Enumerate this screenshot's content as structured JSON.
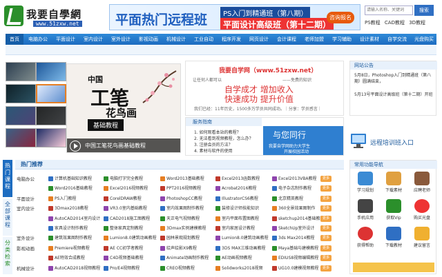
{
  "header": {
    "logo_text": "我要自學網",
    "logo_url": "www.51zxw.net",
    "banner": {
      "main": "平面热门远程班",
      "line1": "PS入门到精通班（第八期）",
      "line2": "平面设计高级班（第十二期）",
      "button": "咨询报名"
    },
    "search_placeholder": "请输入名称、关键词",
    "search_button": "搜索",
    "hot_words": [
      "PS教程",
      "CAD教程",
      "3D教程"
    ]
  },
  "nav": {
    "items": [
      "首页",
      "电脑办公",
      "平面设计",
      "室内设计",
      "室外设计",
      "影视动画",
      "机械设计",
      "工业自动",
      "程序开发",
      "网页设计",
      "会计课程",
      "老师加盟",
      "学习辅助",
      "设计素材",
      "自学交流",
      "光盘购买"
    ]
  },
  "slider": {
    "feature": {
      "cn": "中国",
      "big1": "工笔",
      "big2": "花鸟画",
      "sub": "基础教程",
      "caption": "中国工笔花鸟画基础教程"
    }
  },
  "intro": {
    "heading": "我要自学网（www.51zxw.net）",
    "left_note": "让任何人都可以",
    "right_note": "——免费的知识",
    "slogan1": "自学成才  增加收入",
    "slogan2": "快速成功  提升价值",
    "footer": "我们已经：11年历史，1500多万学员共同成功。｜分享：学员感言｜"
  },
  "guide": {
    "title": "服务指南",
    "items": [
      "1. 如何观看本站的教程？",
      "2. 无法看到视频教程，怎么办？",
      "3. 注册会员的方法？",
      "4. 素材与软件的使用"
    ],
    "card": {
      "title": "与您同行",
      "line1": "我要自学网助力大学生",
      "line2": "开展校园活动"
    }
  },
  "notice": {
    "title": "网站公告",
    "items": [
      "5月8日，Photoshop入门到精通班（第八期）圆满结束，",
      "5月13号平面设计高级班（第十二期）开班"
    ]
  },
  "train": {
    "label": "远程培训班入口"
  },
  "left_tabs": [
    "热门课程",
    "全部课程",
    "分类检索"
  ],
  "hot": {
    "title": "热门推荐",
    "rows": [
      {
        "cat": "电脑办公",
        "items": [
          "计算机基础知识教程",
          "电脑打字完全教程",
          "Word2013基础教程",
          "Excel2013函数教程",
          "Excel2013VBA教程"
        ]
      },
      {
        "cat": "",
        "items": [
          "Word2016基础教程",
          "Excel2016视频教程",
          "PPT2016视频教程",
          "Acrobat2016教程",
          "电子杂志制作教程"
        ]
      },
      {
        "cat": "平面设计",
        "items": [
          "PS入门教程",
          "CorelDRAW教程",
          "PhotoshopCC教程",
          "IllustratorCS6教程",
          "北京精英教程"
        ]
      },
      {
        "cat": "室内设计",
        "items": [
          "3Dmax2018教程",
          "VR3.0室内基础教程",
          "室内效果图制作教程",
          "装修设计师技能知识",
          "360全景效果图制作"
        ]
      },
      {
        "cat": "",
        "items": [
          "AutoCAD2014室内设计",
          "CAD2018施工图教程",
          "天正电气视频教程",
          "室内平面布置图教程",
          "sketchup2014基础教程"
        ]
      },
      {
        "cat": "",
        "items": [
          "家具设计制作教程",
          "整体家具定制教程",
          "3Dmax实例建模教程",
          "室内家居设计教程",
          "SketchUp室外设计"
        ]
      },
      {
        "cat": "室外设计",
        "items": [
          "建筑效果图制作教程",
          "Lumion8.0建筑动画教程",
          "园林景观规划教程",
          "Lumion8.0建筑动画教程",
          "3ds Max2014教程"
        ]
      },
      {
        "cat": "影视动画",
        "items": [
          "Premiere视频教程",
          "AE CC初学者教程",
          "绘声绘影X9教程",
          "3DS MAX三维动画教程",
          "Maya基础与建模教程"
        ]
      },
      {
        "cat": "",
        "items": [
          "AE特效合成教程",
          "C4D视频基础教程",
          "Animate动画制作教程",
          "AE动画视频教程",
          "EDIUS8视频编辑教程"
        ]
      },
      {
        "cat": "机械设计",
        "items": [
          "AutoCAD2018视频教程",
          "Pro/E4视频教程",
          "CREO视频教程",
          "Solidworks2018视频",
          "UG10.0建模视频教程"
        ]
      }
    ],
    "more": "更多"
  },
  "tools": {
    "title": "常用功能导航",
    "items": [
      "学习规划",
      "下载素材",
      "应聘老师",
      "手机应用",
      "获取Vip",
      "购买光盘",
      "获得帮助",
      "下载教材",
      "建议留言"
    ]
  },
  "colors": {
    "nav_blue": "#1d6cc0",
    "accent_red": "#d33",
    "header_blue": "#1d5a9c"
  }
}
